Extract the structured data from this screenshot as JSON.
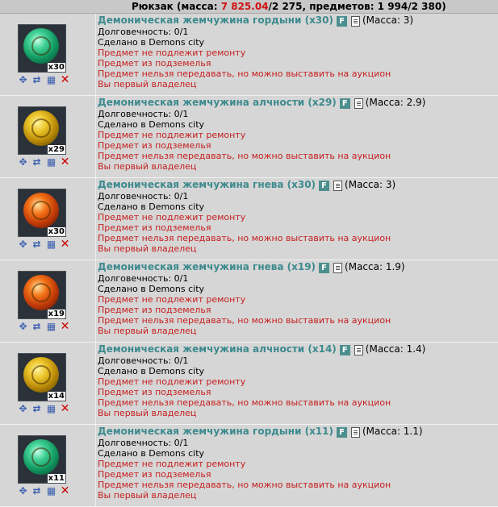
{
  "header": {
    "prefix": "Рюкзак (масса: ",
    "mass_current": "7 825.04",
    "rest": "/2 275, предметов: 1 994/2 380)"
  },
  "labels": {
    "durability": "Долговечность: 0/1",
    "made_in": "Сделано в Demons city",
    "no_repair": "Предмет не подлежит ремонту",
    "from_dungeon": "Предмет из подземелья",
    "no_transfer": "Предмет нельзя передавать, но можно выставить на аукцион",
    "first_owner": "Вы первый владелец",
    "f_badge": "F"
  },
  "actions": {
    "icons": [
      "wrench-icon",
      "swap-icon",
      "grid-icon",
      "delete-icon"
    ]
  },
  "items": [
    {
      "title": "Демоническая жемчужина гордыни (x30)",
      "mass": "(Масса: 3)",
      "qty": "x30",
      "color": "green"
    },
    {
      "title": "Демоническая жемчужина алчности (x29)",
      "mass": "(Масса: 2.9)",
      "qty": "x29",
      "color": "gold"
    },
    {
      "title": "Демоническая жемчужина гнева (x30)",
      "mass": "(Масса: 3)",
      "qty": "x30",
      "color": "red"
    },
    {
      "title": "Демоническая жемчужина гнева (x19)",
      "mass": "(Масса: 1.9)",
      "qty": "x19",
      "color": "red"
    },
    {
      "title": "Демоническая жемчужина алчности (x14)",
      "mass": "(Масса: 1.4)",
      "qty": "x14",
      "color": "gold"
    },
    {
      "title": "Демоническая жемчужина гордыни (x11)",
      "mass": "(Масса: 1.1)",
      "qty": "x11",
      "color": "green"
    }
  ]
}
